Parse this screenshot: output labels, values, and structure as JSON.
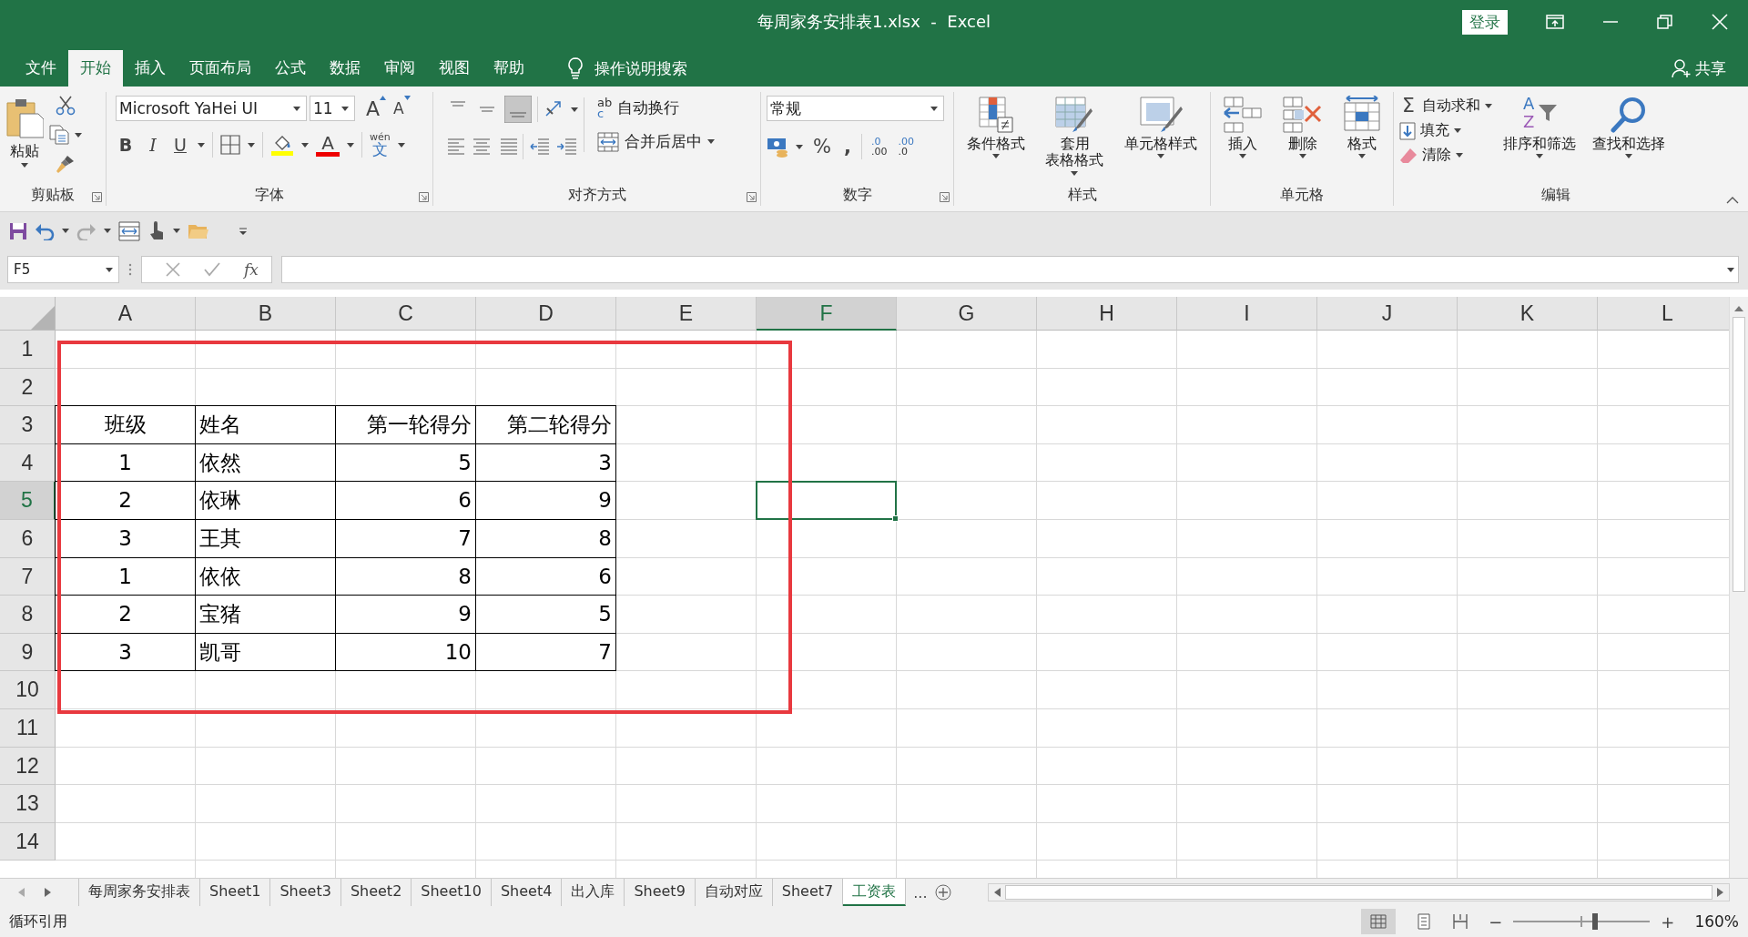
{
  "title_bar": {
    "title": "每周家务安排表1.xlsx  -  Excel",
    "login": "登录"
  },
  "ribbon_tabs": [
    {
      "label": "文件",
      "selected": false
    },
    {
      "label": "开始",
      "selected": true
    },
    {
      "label": "插入",
      "selected": false
    },
    {
      "label": "页面布局",
      "selected": false
    },
    {
      "label": "公式",
      "selected": false
    },
    {
      "label": "数据",
      "selected": false
    },
    {
      "label": "审阅",
      "selected": false
    },
    {
      "label": "视图",
      "selected": false
    },
    {
      "label": "帮助",
      "selected": false
    }
  ],
  "tell_me": "操作说明搜索",
  "share": "共享",
  "ribbon_groups": [
    {
      "kind": "clipboard",
      "label": "剪贴板",
      "paste": "粘贴"
    },
    {
      "kind": "font",
      "label": "字体",
      "font_name": "Microsoft YaHei UI",
      "font_size": "11",
      "grow": "A",
      "shrink": "A",
      "styles": [
        "B",
        "I",
        "U"
      ],
      "font_color": "A",
      "phonetic": "wén",
      "phonetic_char": "文"
    },
    {
      "kind": "alignment",
      "label": "对齐方式",
      "wrap_icon": [
        "ab",
        "c"
      ],
      "wrap": "自动换行",
      "merge": "合并后居中"
    },
    {
      "kind": "number",
      "label": "数字",
      "format": "常规",
      "symbols": [
        "%",
        ","
      ],
      "decimals": [
        [
          ".0",
          ".00"
        ],
        [
          ".00",
          ".0"
        ]
      ]
    },
    {
      "kind": "buttons",
      "label": "样式",
      "buttons": [
        {
          "kind": "conditional",
          "label": "条件格式"
        },
        {
          "kind": "table",
          "label": "套用表格格式"
        },
        {
          "kind": "cell_style",
          "label": "单元格样式"
        }
      ]
    },
    {
      "kind": "buttons",
      "label": "单元格",
      "buttons": [
        {
          "kind": "insert",
          "label": "插入"
        },
        {
          "kind": "delete",
          "label": "删除"
        },
        {
          "kind": "format",
          "label": "格式"
        }
      ]
    },
    {
      "kind": "editing",
      "label": "编辑",
      "small": [
        {
          "kind": "sum",
          "symbol": "Σ",
          "label": "自动求和"
        },
        {
          "kind": "fill",
          "label": "填充"
        },
        {
          "kind": "clear",
          "label": "清除"
        }
      ],
      "buttons": [
        {
          "kind": "sort",
          "label": "排序和筛选",
          "letters": [
            "A",
            "Z"
          ]
        },
        {
          "kind": "find",
          "label": "查找和选择"
        }
      ]
    }
  ],
  "formula_bar": {
    "name_box": "F5",
    "function_label": "fx"
  },
  "sheet": {
    "columns": [
      {
        "label": "A",
        "selected": false
      },
      {
        "label": "B",
        "selected": false
      },
      {
        "label": "C",
        "selected": false
      },
      {
        "label": "D",
        "selected": false
      },
      {
        "label": "E",
        "selected": false
      },
      {
        "label": "F",
        "selected": true
      },
      {
        "label": "G",
        "selected": false
      },
      {
        "label": "H",
        "selected": false
      },
      {
        "label": "I",
        "selected": false
      },
      {
        "label": "J",
        "selected": false
      },
      {
        "label": "K",
        "selected": false
      },
      {
        "label": "L",
        "selected": false
      }
    ],
    "rows": [
      {
        "label": "1",
        "selected": false
      },
      {
        "label": "2",
        "selected": false
      },
      {
        "label": "3",
        "selected": false,
        "cells": [
          "班级",
          "姓名",
          "第一轮得分",
          "第二轮得分"
        ]
      },
      {
        "label": "4",
        "selected": false,
        "cells": [
          "1",
          "依然",
          "5",
          "3"
        ]
      },
      {
        "label": "5",
        "selected": true,
        "cells": [
          "2",
          "依琳",
          "6",
          "9"
        ]
      },
      {
        "label": "6",
        "selected": false,
        "cells": [
          "3",
          "王其",
          "7",
          "8"
        ]
      },
      {
        "label": "7",
        "selected": false,
        "cells": [
          "1",
          "依依",
          "8",
          "6"
        ]
      },
      {
        "label": "8",
        "selected": false,
        "cells": [
          "2",
          "宝猪",
          "9",
          "5"
        ]
      },
      {
        "label": "9",
        "selected": false,
        "cells": [
          "3",
          "凯哥",
          "10",
          "7"
        ]
      },
      {
        "label": "10",
        "selected": false
      },
      {
        "label": "11",
        "selected": false
      },
      {
        "label": "12",
        "selected": false
      },
      {
        "label": "13",
        "selected": false
      },
      {
        "label": "14",
        "selected": false
      }
    ]
  },
  "sheet_tabs": [
    {
      "label": "每周家务安排表",
      "selected": false
    },
    {
      "label": "Sheet1",
      "selected": false
    },
    {
      "label": "Sheet3",
      "selected": false
    },
    {
      "label": "Sheet2",
      "selected": false
    },
    {
      "label": "Sheet10",
      "selected": false
    },
    {
      "label": "Sheet4",
      "selected": false
    },
    {
      "label": "出入库",
      "selected": false
    },
    {
      "label": "Sheet9",
      "selected": false
    },
    {
      "label": "自动对应",
      "selected": false
    },
    {
      "label": "Sheet7",
      "selected": false
    },
    {
      "label": "工资表",
      "selected": true
    }
  ],
  "sheet_tabs_more": "...",
  "status_bar": {
    "message": "循环引用",
    "zoom_out": "−",
    "zoom_in": "+",
    "level": 0.6,
    "zoom": "160%"
  }
}
